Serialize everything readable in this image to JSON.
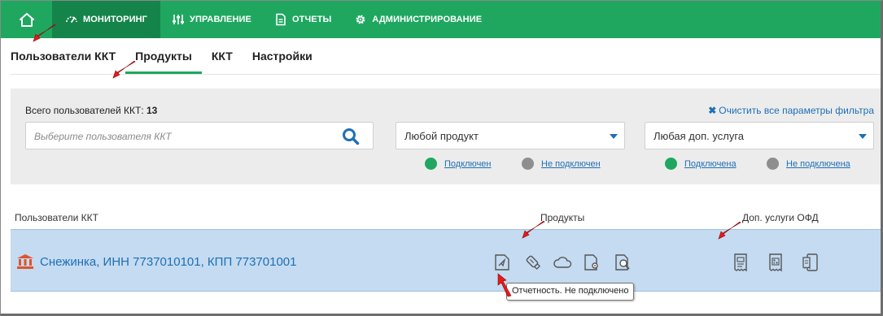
{
  "nav": {
    "items": [
      {
        "label": "Мониторинг",
        "icon": "speedometer-icon",
        "active": true
      },
      {
        "label": "Управление",
        "icon": "sliders-icon",
        "active": false
      },
      {
        "label": "Отчеты",
        "icon": "document-icon",
        "active": false
      },
      {
        "label": "Администрирование",
        "icon": "gear-icon",
        "active": false
      }
    ]
  },
  "subtabs": [
    {
      "label": "Пользователи ККТ"
    },
    {
      "label": "Продукты"
    },
    {
      "label": "ККТ"
    },
    {
      "label": "Настройки"
    }
  ],
  "filter": {
    "total_label": "Всего пользователей ККТ:",
    "total_value": "13",
    "clear_label": "Очистить все параметры фильтра",
    "search_placeholder": "Выберите пользователя ККТ",
    "product_select": "Любой продукт",
    "service_select": "Любая доп. услуга",
    "product_legend": {
      "on": "Подключен",
      "off": "Не подключен"
    },
    "service_legend": {
      "on": "Подключена",
      "off": "Не подключена"
    }
  },
  "table": {
    "col_users": "Пользователи ККТ",
    "col_products": "Продукты",
    "col_services": "Доп. услуги ОФД",
    "row": {
      "title": "Снежинка, ИНН 7737010101, КПП 773701001",
      "product_icons": [
        "report-send-icon",
        "usb-key-icon",
        "cloud-icon",
        "document-settings-icon",
        "search-document-icon"
      ],
      "service_icons": [
        "receipt-icon",
        "qr-receipt-icon",
        "mobile-receipt-icon"
      ]
    },
    "tooltip": "Отчетность. Не подключено"
  },
  "colors": {
    "nav_bg": "#1fa760",
    "nav_active": "#15844a",
    "link": "#1f6fb5",
    "row_bg": "#c4dbf1",
    "arrow": "#e8191a"
  }
}
